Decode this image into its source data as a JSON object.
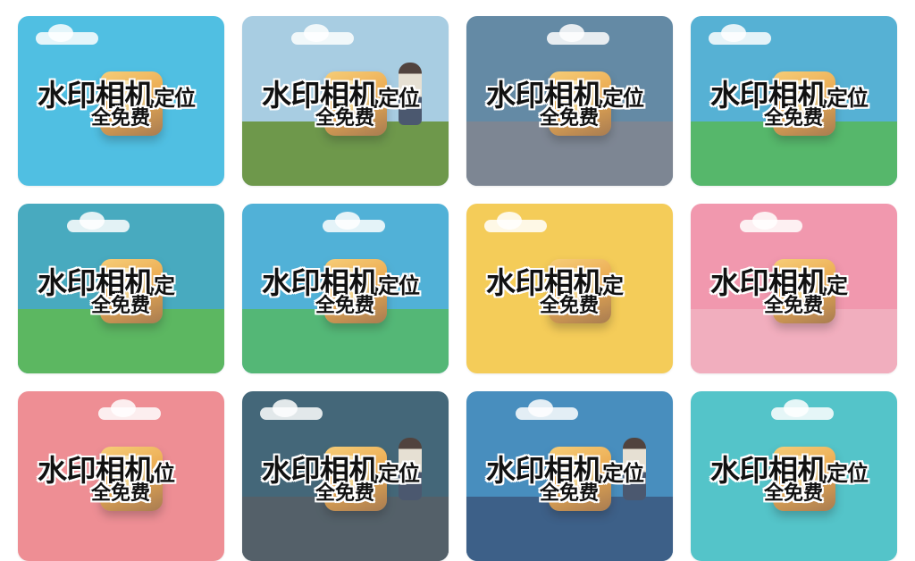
{
  "gallery": {
    "tiles": [
      {
        "title": "水印相机",
        "suffix": "定位",
        "subtitle": "全免费",
        "scene": "plain",
        "sky": "#38b7df",
        "ground": "#38b7df"
      },
      {
        "title": "水印相机",
        "suffix": "定位",
        "subtitle": "全免费",
        "scene": "person-grass",
        "sky": "#9cc6df",
        "ground": "#5a8a33"
      },
      {
        "title": "水印相机",
        "suffix": "定位",
        "subtitle": "全免费",
        "scene": "street",
        "sky": "#4f7a99",
        "ground": "#6c7685"
      },
      {
        "title": "水印相机",
        "suffix": "定位",
        "subtitle": "全免费",
        "scene": "hill",
        "sky": "#3fa7cf",
        "ground": "#3fae57"
      },
      {
        "title": "水印相机",
        "suffix": "定",
        "subtitle": "全免费",
        "scene": "hill",
        "sky": "#2f9fb7",
        "ground": "#46ad4c"
      },
      {
        "title": "水印相机",
        "suffix": "定位",
        "subtitle": "全免费",
        "scene": "hill",
        "sky": "#3aa7d2",
        "ground": "#3dae64"
      },
      {
        "title": "水印相机",
        "suffix": "定",
        "subtitle": "全免费",
        "scene": "plain",
        "sky": "#f3c542",
        "ground": "#f5c84a"
      },
      {
        "title": "水印相机",
        "suffix": "定",
        "subtitle": "全免费",
        "scene": "paper",
        "sky": "#ef8aa3",
        "ground": "#f0a3b5"
      },
      {
        "title": "水印相机",
        "suffix": "位",
        "subtitle": "全免费",
        "scene": "plain",
        "sky": "#ec7f86",
        "ground": "#ee8e92"
      },
      {
        "title": "水印相机",
        "suffix": "定位",
        "subtitle": "全免费",
        "scene": "person-dark",
        "sky": "#2b5367",
        "ground": "#3d4b55"
      },
      {
        "title": "水印相机",
        "suffix": "定位",
        "subtitle": "全免费",
        "scene": "person-city",
        "sky": "#2f7fb6",
        "ground": "#234a78"
      },
      {
        "title": "水印相机",
        "suffix": "定位",
        "subtitle": "全免费",
        "scene": "plain",
        "sky": "#3dbcc2",
        "ground": "#3fc0c3"
      }
    ]
  }
}
